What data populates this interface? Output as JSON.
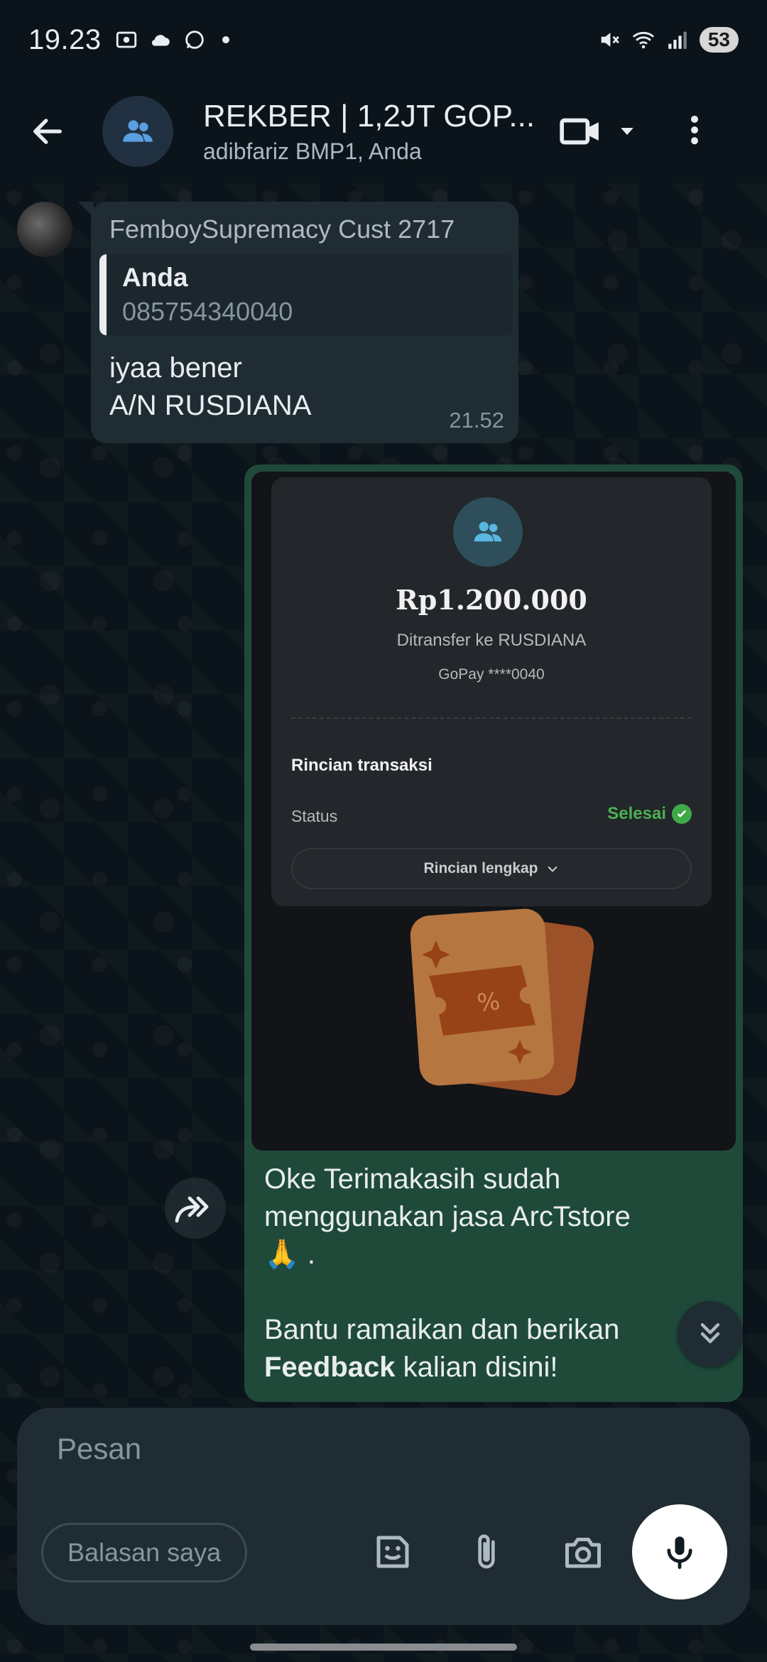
{
  "status_bar": {
    "time": "19.23",
    "battery": "53"
  },
  "header": {
    "title": "REKBER | 1,2JT GOP...",
    "subtitle": "adibfariz BMP1, Anda"
  },
  "incoming": {
    "sender": "FemboySupremacy Cust 2717",
    "quote_author": "Anda",
    "quote_text": "085754340040",
    "line1": "iyaa bener",
    "line2": "A/N RUSDIANA",
    "time": "21.52"
  },
  "receipt": {
    "amount": "Rp1.200.000",
    "transfer_to": "Ditransfer ke RUSDIANA",
    "account": "GoPay ****0040",
    "details_title": "Rincian transaksi",
    "status_label": "Status",
    "status_value": "Selesai",
    "details_button": "Rincian lengkap"
  },
  "outgoing": {
    "line1": "Oke Terimakasih sudah",
    "line2": "menggunakan jasa ArcTstore",
    "line3": "🙏 .",
    "line4": "Bantu ramaikan dan berikan",
    "bold_word": "Feedback",
    "line5_rest": " kalian disini!"
  },
  "composer": {
    "placeholder": "Pesan",
    "chip": "Balasan saya"
  },
  "colors": {
    "background": "#0b141a",
    "incoming_bubble": "#202c33",
    "outgoing_bubble": "#1f4a3a",
    "status_done": "#4caf50"
  },
  "icons": [
    "back-arrow-icon",
    "group-icon",
    "video-call-icon",
    "chevron-down-icon",
    "more-vert-icon",
    "forward-icon",
    "double-chevron-down-icon",
    "sticker-icon",
    "attach-icon",
    "camera-icon",
    "mic-icon"
  ]
}
